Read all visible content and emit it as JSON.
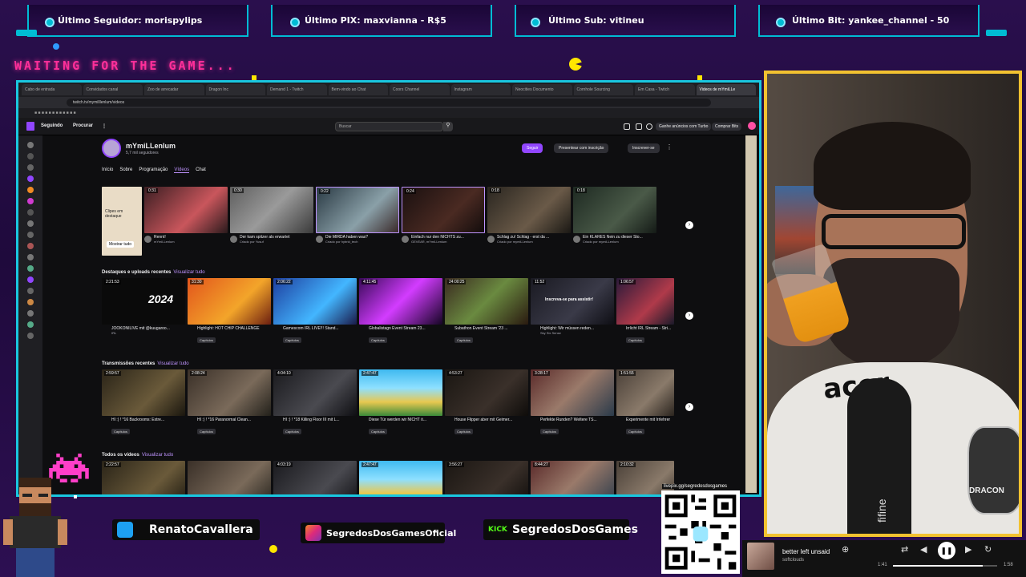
{
  "overlay": {
    "alerts": [
      {
        "label": "Último Seguidor: morispylips"
      },
      {
        "label": "Último PIX: maxvianna - R$5"
      },
      {
        "label": "Último Sub: vitineu"
      },
      {
        "label": "Último Bit: yankee_channel - 50"
      }
    ],
    "waiting_text": "WAITING FOR THE GAME...",
    "accent": "#00bcd4",
    "pink": "#ff2f9a"
  },
  "browser": {
    "tabs": [
      "Cabo de entrada",
      "Convidados canal",
      "Zoo de arrecadar",
      "Dragon Inc",
      "Demand 1 - Twitch",
      "Bem-vindo ao Chat",
      "Coors Channel",
      "Instagram",
      "Neocities Documento",
      "Cornhole Sourcing",
      "Em Casa - Twitch",
      "Videos de mYmiLLe"
    ],
    "url": "twitch.tv/mymilllenlum/videos"
  },
  "twitch": {
    "nav": {
      "following": "Seguindo",
      "browse": "Procurar",
      "search_placeholder": "Buscar",
      "turbo": "Ganhe anúncios com Turbo",
      "bits": "Comprar Bits"
    },
    "channel": {
      "name": "mYmiLLenlum",
      "followers": "5,7 mil seguidores",
      "follow": "Seguir",
      "gift": "Presentear com inscrição",
      "subscribe": "Inscrever-se"
    },
    "tabs": [
      "Início",
      "Sobre",
      "Programação",
      "Vídeos",
      "Chat"
    ],
    "featured_label": "Clipes em destaque",
    "show_all": "Mostrar tudo",
    "sections": [
      {
        "title": "Destaques e uploads recentes",
        "link": "Visualizar tudo"
      },
      {
        "title": "Transmissões recentes",
        "link": "Visualizar tudo"
      },
      {
        "title": "Todos os vídeos",
        "link": "Visualizar tudo"
      }
    ],
    "row1": [
      {
        "dur": "0:31",
        "title": "Rennt!",
        "meta": "mYmiLLenlum"
      },
      {
        "dur": "0:30",
        "title": "Der kam spitzer als erwartet",
        "meta": "Criado por Yusuf"
      },
      {
        "dur": "0:22",
        "title": "Die MIRDA haben was?",
        "meta": "Criado por hybrid_tech"
      },
      {
        "dur": "0:24",
        "title": "Einfach nur den NICHTS zu...",
        "meta": "GEVEAR, mYmiLLenlum"
      },
      {
        "dur": "0:18",
        "title": "Schlag zu! Schlag - erst da ...",
        "meta": "Criado por mymiLLenlum"
      },
      {
        "dur": "0:18",
        "title": "Ein KLARES Nein zu dieser Sto...",
        "meta": "Criado por mymiLLenlum"
      }
    ],
    "row2": [
      {
        "dur": "2:21:53",
        "title": "JOOKONILIVE mit @kuugaroo...",
        "meta": "IRL"
      },
      {
        "dur": "31:30",
        "title": "Highlight: HOT CHIP CHALLENGE",
        "meta": "Capítulos"
      },
      {
        "dur": "2:06:22",
        "title": "Gamescom IRL LIVE!!! Stand...",
        "meta": "Capítulos"
      },
      {
        "dur": "4:11:45",
        "title": "Globalistagn Event Stream 23...",
        "meta": "Capítulos"
      },
      {
        "dur": "24:00:25",
        "title": "Subathon Event Stream '23 ...",
        "meta": "Capítulos"
      },
      {
        "dur": "11:52",
        "title": "Highlight: Wir müssen reden...",
        "meta": "Sky Six Sense"
      },
      {
        "dur": "1:06:57",
        "title": "Irrlicht IRL Stream - Stri...",
        "meta": "Capítulos"
      }
    ],
    "row2_overlay": "Inscreva-se para assistir!",
    "row3": [
      {
        "dur": "2:59:57",
        "title": "HI :) ! *16 Backrooms: Extre...",
        "meta": "Capítulos"
      },
      {
        "dur": "2:08:24",
        "title": "HI :) ! *16 Paranormal Clean...",
        "meta": "Capítulos"
      },
      {
        "dur": "4:04:10",
        "title": "HI :) ! *18 Killing Floor III mit L...",
        "meta": "Capítulos"
      },
      {
        "dur": "2:47:47",
        "title": "Diese Tür werden wir NICHT ö...",
        "meta": "Capítulos"
      },
      {
        "dur": "4:53:27",
        "title": "House Flipper aber mit Geimer...",
        "meta": "Capítulos"
      },
      {
        "dur": "3:28:17",
        "title": "Perfekte Runden? Weltere TS...",
        "meta": "Capítulos"
      },
      {
        "dur": "1:51:55",
        "title": "Experimente mit Irrlehrer",
        "meta": "Capítulos"
      }
    ],
    "row4": [
      {
        "dur": "2:22:57"
      },
      {
        "dur": ""
      },
      {
        "dur": "4:03:19"
      },
      {
        "dur": "2:47:47"
      },
      {
        "dur": "3:56:27"
      },
      {
        "dur": "8:44:27"
      },
      {
        "dur": "2:10:32"
      }
    ]
  },
  "webcam": {
    "shirt_text": "acer",
    "mic_brand": "fifine",
    "team_text": "DRACON"
  },
  "socials": [
    {
      "handle": "RenatoCavallera",
      "icon": "twitter-icon"
    },
    {
      "handle": "SegredosDosGamesOficial",
      "icon": "instagram-icon"
    },
    {
      "handle": "SegredosDosGames",
      "icon": "kick-icon",
      "badge": "KICK"
    }
  ],
  "livepix_url": "livepix.gg/segredosdosgames",
  "player": {
    "track": "better left unsaid",
    "artist": "softclouds",
    "elapsed": "1:41",
    "total": "1:58",
    "progress": 0.86
  }
}
